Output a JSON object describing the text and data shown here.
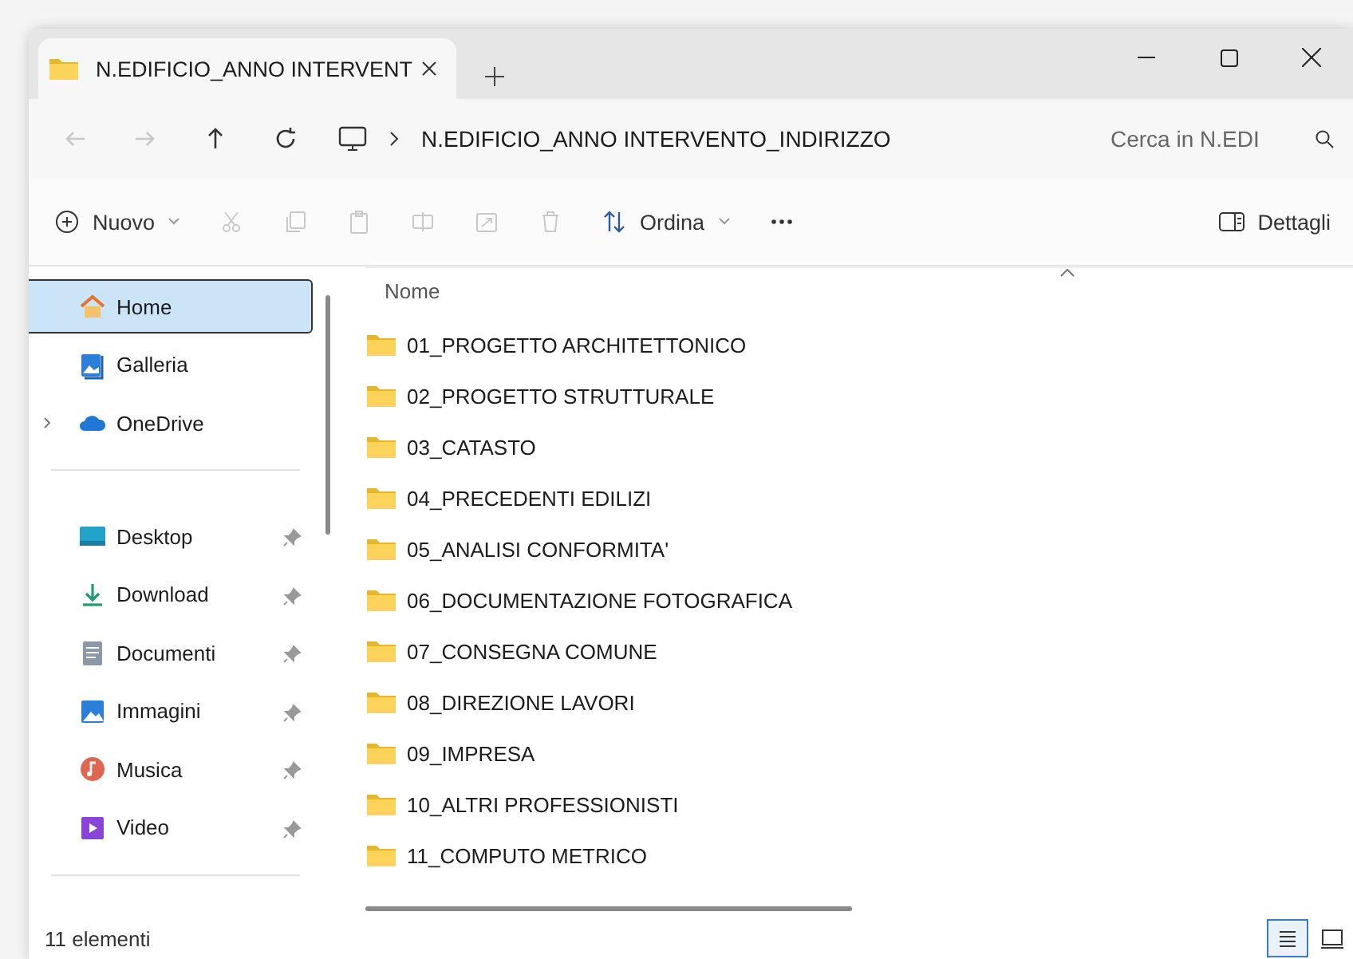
{
  "tab": {
    "title": "N.EDIFICIO_ANNO INTERVENT",
    "selected": true
  },
  "nav_buttons": [
    {
      "kind": "back",
      "disabled": true
    },
    {
      "kind": "forward",
      "disabled": true
    },
    {
      "kind": "up",
      "disabled": false
    },
    {
      "kind": "refresh",
      "disabled": false
    }
  ],
  "address": {
    "path": "N.EDIFICIO_ANNO INTERVENTO_INDIRIZZO"
  },
  "search": {
    "placeholder": "Cerca in N.EDI"
  },
  "toolbar": [
    {
      "kind": "new",
      "label": "Nuovo",
      "disabled": false
    },
    {
      "kind": "cut",
      "disabled": true
    },
    {
      "kind": "copy",
      "disabled": true
    },
    {
      "kind": "paste",
      "disabled": true
    },
    {
      "kind": "rename",
      "disabled": true
    },
    {
      "kind": "share",
      "disabled": true
    },
    {
      "kind": "delete",
      "disabled": true
    },
    {
      "kind": "sort",
      "label": "Ordina",
      "disabled": false
    },
    {
      "kind": "more",
      "disabled": false
    }
  ],
  "details_button": {
    "label": "Dettagli"
  },
  "sidebar": {
    "sections": [
      {
        "items": [
          {
            "label": "Home",
            "kind": "home",
            "selected": true,
            "pinned": false,
            "expandable": false
          },
          {
            "label": "Galleria",
            "kind": "gallery",
            "selected": false,
            "pinned": false,
            "expandable": false
          },
          {
            "label": "OneDrive",
            "kind": "cloud",
            "selected": false,
            "pinned": false,
            "expandable": true
          }
        ]
      },
      {
        "items": [
          {
            "label": "Desktop",
            "kind": "desktop",
            "selected": false,
            "pinned": true,
            "expandable": false
          },
          {
            "label": "Download",
            "kind": "download",
            "selected": false,
            "pinned": true,
            "expandable": false
          },
          {
            "label": "Documenti",
            "kind": "document",
            "selected": false,
            "pinned": true,
            "expandable": false
          },
          {
            "label": "Immagini",
            "kind": "picture",
            "selected": false,
            "pinned": true,
            "expandable": false
          },
          {
            "label": "Musica",
            "kind": "music",
            "selected": false,
            "pinned": true,
            "expandable": false
          },
          {
            "label": "Video",
            "kind": "video",
            "selected": false,
            "pinned": true,
            "expandable": false
          }
        ]
      }
    ]
  },
  "table": {
    "columns": [
      "Nome"
    ],
    "rows": [
      "01_PROGETTO ARCHITETTONICO",
      "02_PROGETTO STRUTTURALE",
      "03_CATASTO",
      "04_PRECEDENTI EDILIZI",
      "05_ANALISI CONFORMITA'",
      "06_DOCUMENTAZIONE FOTOGRAFICA",
      "07_CONSEGNA COMUNE",
      "08_DIREZIONE LAVORI",
      "09_IMPRESA",
      "10_ALTRI PROFESSIONISTI",
      "11_COMPUTO METRICO"
    ]
  },
  "status_bar": {
    "count": "11 elementi"
  },
  "view_buttons": [
    {
      "kind": "details",
      "selected": true
    },
    {
      "kind": "tiles",
      "selected": false
    }
  ]
}
